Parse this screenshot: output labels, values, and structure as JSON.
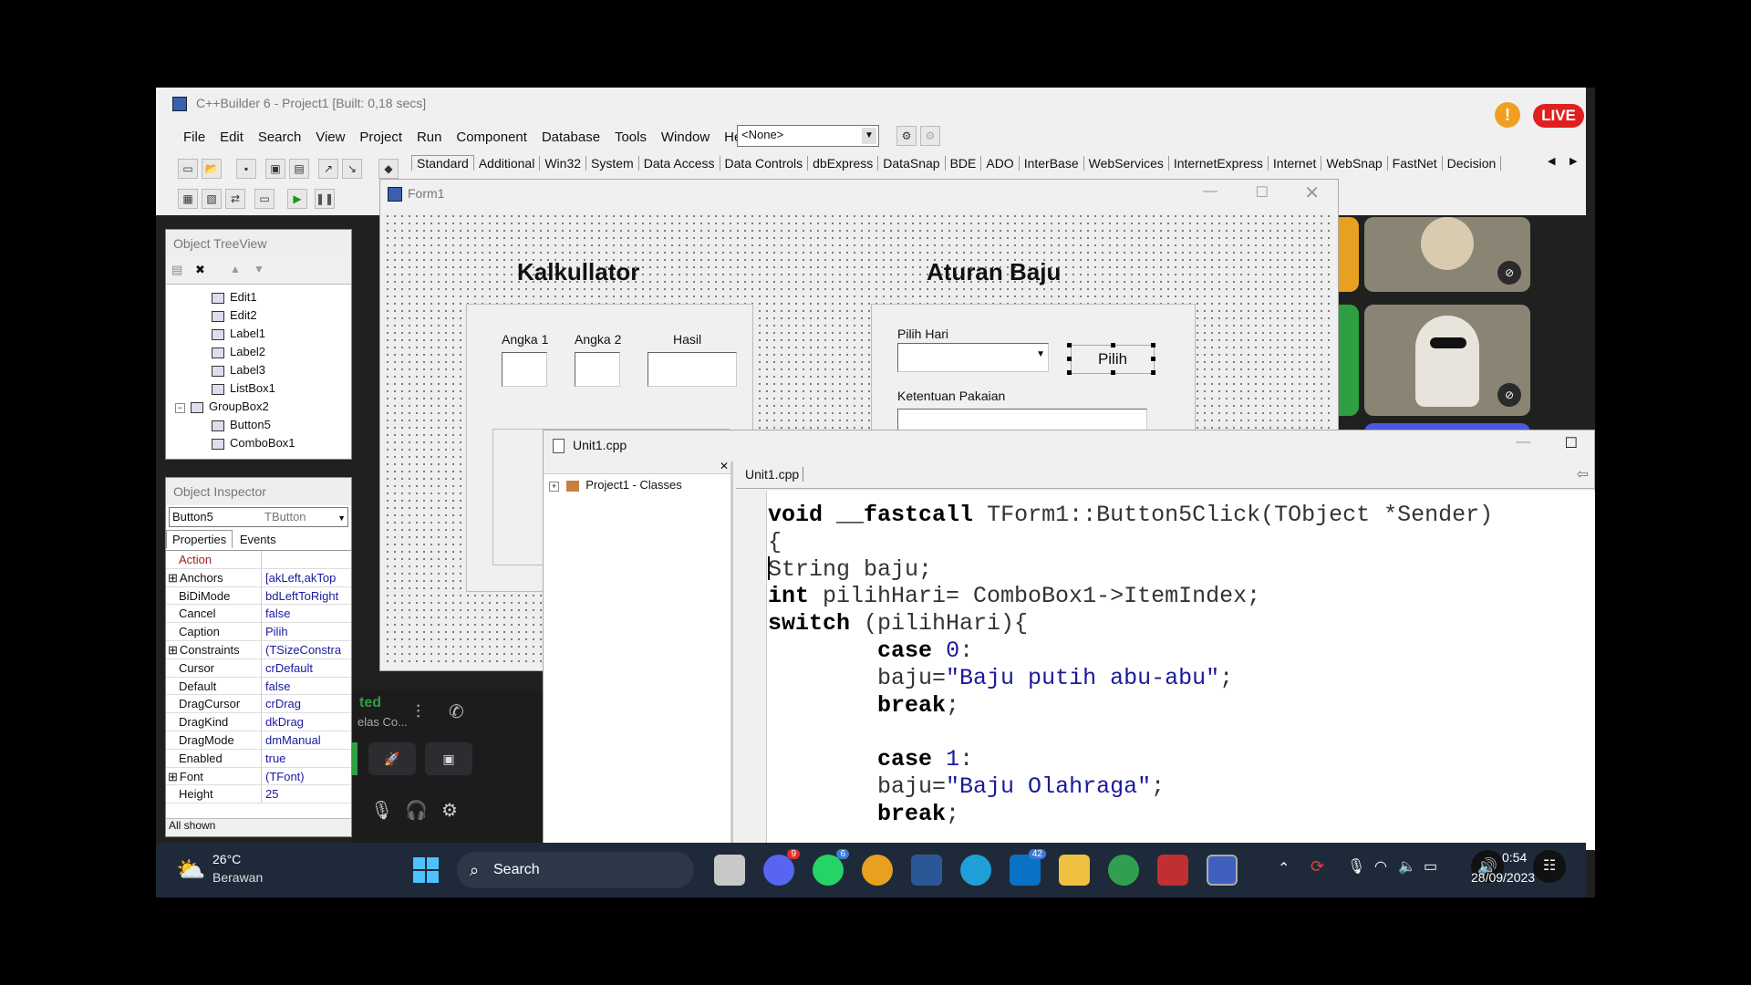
{
  "ide": {
    "title": "C++Builder 6 - Project1 [Built: 0,18 secs]",
    "menu": [
      "File",
      "Edit",
      "Search",
      "View",
      "Project",
      "Run",
      "Component",
      "Database",
      "Tools",
      "Window",
      "Help"
    ],
    "config_select": "<None>",
    "palette_tabs": [
      "Standard",
      "Additional",
      "Win32",
      "System",
      "Data Access",
      "Data Controls",
      "dbExpress",
      "DataSnap",
      "BDE",
      "ADO",
      "InterBase",
      "WebServices",
      "InternetExpress",
      "Internet",
      "WebSnap",
      "FastNet",
      "Decision"
    ]
  },
  "object_treeview": {
    "title": "Object TreeView",
    "items": [
      "Edit1",
      "Edit2",
      "Label1",
      "Label2",
      "Label3",
      "ListBox1",
      "GroupBox2",
      "Button5",
      "ComboBox1"
    ]
  },
  "object_inspector": {
    "title": "Object Inspector",
    "selected_object": "Button5",
    "selected_type": "TButton",
    "tabs": [
      "Properties",
      "Events"
    ],
    "properties": [
      {
        "name": "Action",
        "value": ""
      },
      {
        "name": "Anchors",
        "value": "[akLeft,akTop"
      },
      {
        "name": "BiDiMode",
        "value": "bdLeftToRight"
      },
      {
        "name": "Cancel",
        "value": "false"
      },
      {
        "name": "Caption",
        "value": "Pilih"
      },
      {
        "name": "Constraints",
        "value": "(TSizeConstra"
      },
      {
        "name": "Cursor",
        "value": "crDefault"
      },
      {
        "name": "Default",
        "value": "false"
      },
      {
        "name": "DragCursor",
        "value": "crDrag"
      },
      {
        "name": "DragKind",
        "value": "dkDrag"
      },
      {
        "name": "DragMode",
        "value": "dmManual"
      },
      {
        "name": "Enabled",
        "value": "true"
      },
      {
        "name": "Font",
        "value": "(TFont)"
      },
      {
        "name": "Height",
        "value": "25"
      }
    ],
    "footer": "All shown"
  },
  "form1": {
    "title": "Form1",
    "heading_left": "Kalkullator",
    "heading_right": "Aturan Baju",
    "label_angka1": "Angka 1",
    "label_angka2": "Angka 2",
    "label_hasil": "Hasil",
    "label_pilih_hari": "Pilih Hari",
    "button_pilih": "Pilih",
    "label_ketentuan": "Ketentuan Pakaian"
  },
  "editor": {
    "title": "Unit1.cpp",
    "tab": "Unit1.cpp",
    "classes_root": "Project1 - Classes"
  },
  "meeting": {
    "live_badge": "LIVE",
    "status_partial": "ted",
    "channel_partial": "elas Co..."
  },
  "taskbar": {
    "weather_temp": "26°C",
    "weather_desc": "Berawan",
    "search_label": "Search",
    "time": "0:54",
    "date": "28/09/2023",
    "badges": {
      "discord": "9",
      "whatsapp": "6",
      "mail": "42"
    }
  }
}
